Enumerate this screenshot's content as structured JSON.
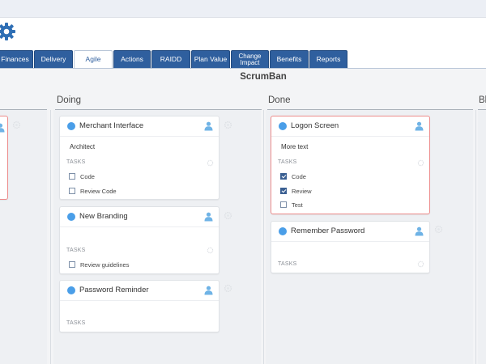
{
  "tabs": [
    {
      "label": "Finances"
    },
    {
      "label": "Delivery"
    },
    {
      "label": "Agile",
      "active": true
    },
    {
      "label": "Actions"
    },
    {
      "label": "RAIDD"
    },
    {
      "label": "Plan Value"
    },
    {
      "label": "Change Impact"
    },
    {
      "label": "Benefits"
    },
    {
      "label": "Reports"
    }
  ],
  "board": {
    "title": "ScrumBan",
    "columns": [
      {
        "name": "Doing"
      },
      {
        "name": "Done"
      },
      {
        "name": "Bl"
      }
    ]
  },
  "cards": {
    "merchant": {
      "title": "Merchant Interface",
      "desc": "Architect",
      "tasks_label": "TASKS",
      "tasks": [
        {
          "label": "Code",
          "done": false
        },
        {
          "label": "Review Code",
          "done": false
        }
      ]
    },
    "branding": {
      "title": "New Branding",
      "tasks_label": "TASKS",
      "tasks": [
        {
          "label": "Review guidelines",
          "done": false
        }
      ]
    },
    "password": {
      "title": "Password Reminder",
      "tasks_label": "TASKS"
    },
    "logon": {
      "title": "Logon Screen",
      "desc": "More text",
      "tasks_label": "TASKS",
      "tasks": [
        {
          "label": "Code",
          "done": true
        },
        {
          "label": "Review",
          "done": true
        },
        {
          "label": "Test",
          "done": false
        }
      ]
    },
    "remember": {
      "title": "Remember Password",
      "tasks_label": "TASKS"
    }
  },
  "colors": {
    "tab": "#2f5f9e",
    "dot": "#4a9ee8",
    "flag_border": "#ec8b8b",
    "checkbox_checked": "#3a5f92"
  },
  "icons": {
    "settings": "gear-icon",
    "owner": "user-icon",
    "card_settings": "gear-icon"
  }
}
